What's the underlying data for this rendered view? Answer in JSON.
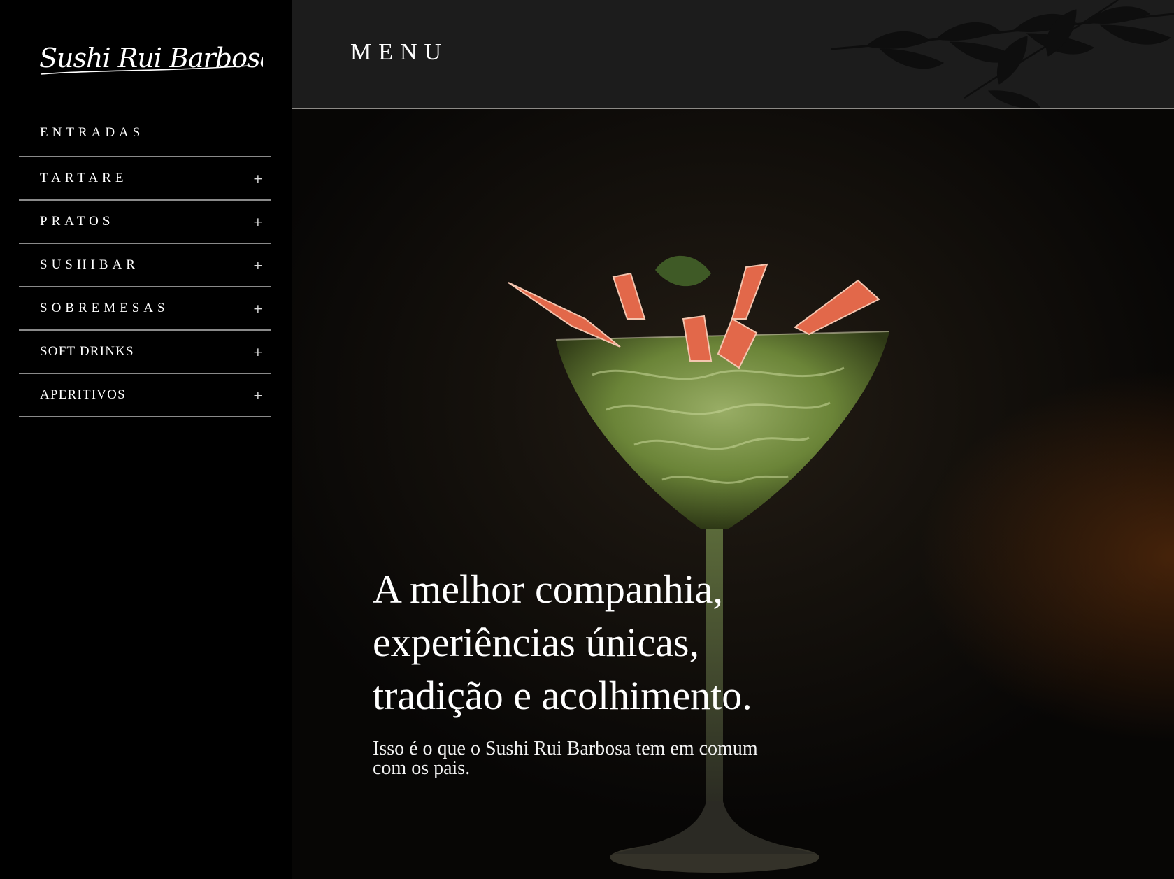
{
  "brand": {
    "logo_text": "Sushi Rui Barbosa"
  },
  "header": {
    "title": "MENU"
  },
  "sidebar": {
    "items": [
      {
        "label": "ENTRADAS",
        "expand_icon": ""
      },
      {
        "label": "TARTARE",
        "expand_icon": "+"
      },
      {
        "label": "PRATOS",
        "expand_icon": "+"
      },
      {
        "label": "SUSHIBAR",
        "expand_icon": "+"
      },
      {
        "label": "SOBREMESAS",
        "expand_icon": "+"
      },
      {
        "label": "SOFT DRINKS",
        "expand_icon": "+"
      },
      {
        "label": "APERITIVOS",
        "expand_icon": "+"
      }
    ]
  },
  "hero": {
    "heading": "A melhor companhia,\nexperiências únicas,\ntradição e acolhimento.",
    "subtitle": "Isso é o que o Sushi Rui Barbosa tem em comum com os pais."
  },
  "colors": {
    "sidebar_bg": "#000000",
    "header_bg": "#1c1c1c",
    "divider": "#8a8a8a",
    "text": "#ffffff",
    "accent_glow": "#783a0e"
  },
  "icons": [
    "plus-icon",
    "leaves-decoration"
  ]
}
